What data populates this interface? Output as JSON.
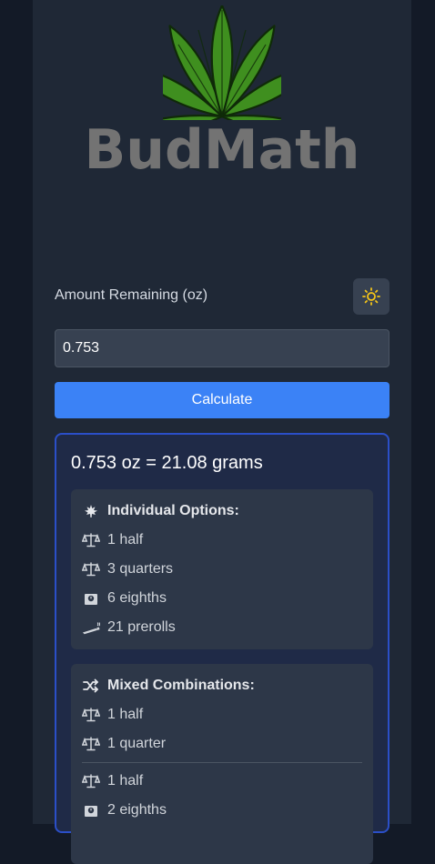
{
  "app": {
    "brand": "BudMath",
    "colors": {
      "accent": "#3b82f6",
      "panel": "#1f2836",
      "result_border": "#2b4fc8",
      "leaf": "#3f8f1f"
    }
  },
  "form": {
    "amount_label": "Amount Remaining (oz)",
    "amount_value": "0.753",
    "calculate_label": "Calculate",
    "theme_icon": "sun-icon"
  },
  "result": {
    "summary": "0.753 oz = 21.08 grams",
    "individual": {
      "heading": "Individual Options:",
      "heading_icon": "leaf-icon",
      "items": [
        {
          "icon": "scale-icon",
          "label": "1 half"
        },
        {
          "icon": "scale-icon",
          "label": "3 quarters"
        },
        {
          "icon": "weight-icon",
          "label": "6 eighths"
        },
        {
          "icon": "joint-icon",
          "label": "21 prerolls"
        }
      ]
    },
    "mixed": {
      "heading": "Mixed Combinations:",
      "heading_icon": "shuffle-icon",
      "combos": [
        [
          {
            "icon": "scale-icon",
            "label": "1 half"
          },
          {
            "icon": "scale-icon",
            "label": "1 quarter"
          }
        ],
        [
          {
            "icon": "scale-icon",
            "label": "1 half"
          },
          {
            "icon": "weight-icon",
            "label": "2 eighths"
          }
        ]
      ]
    }
  }
}
